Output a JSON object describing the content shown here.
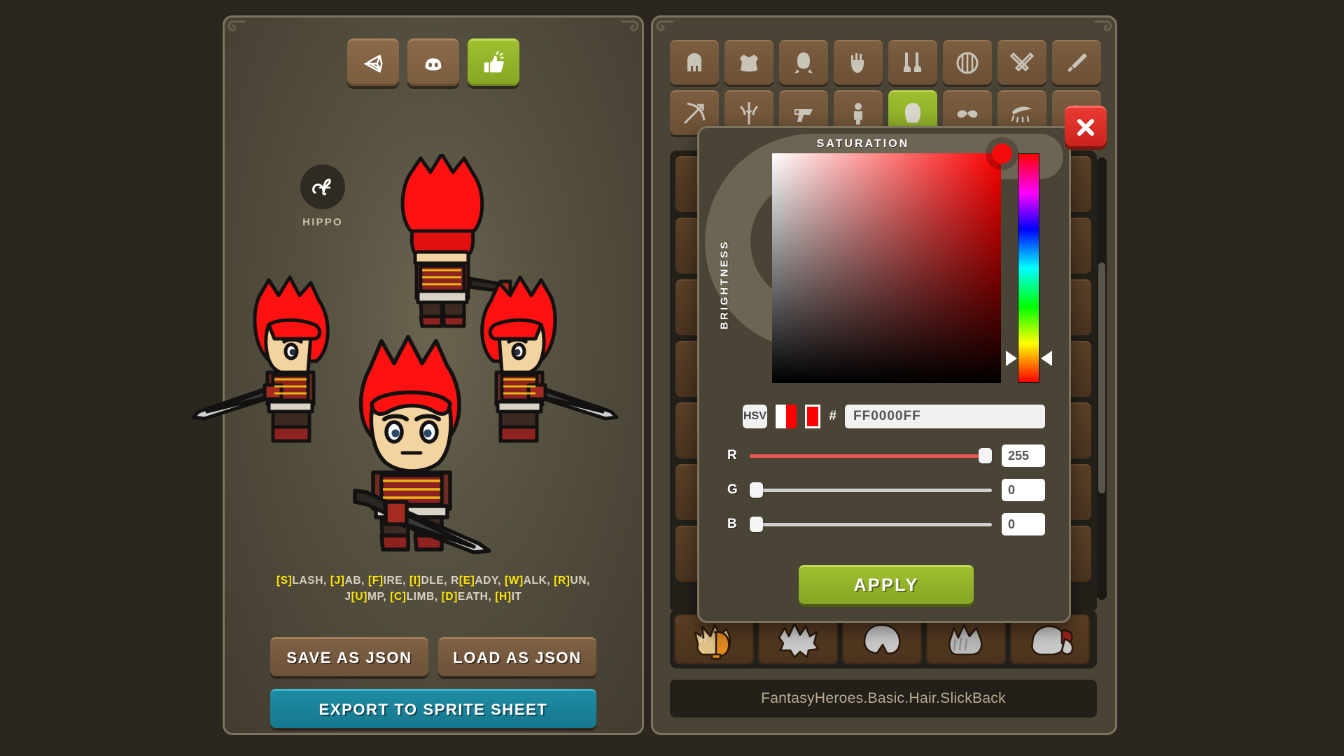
{
  "app": {
    "background_color": "#2b261e",
    "panel_color": "#4a4436",
    "panel_border_color": "#7d7460",
    "accent_green": "#93b329",
    "accent_teal": "#1e8ba3",
    "accent_red": "#d62a22",
    "highlight_yellow": "#ffe600"
  },
  "left_panel": {
    "toolbar": [
      {
        "name": "unity-icon",
        "label": "Unity"
      },
      {
        "name": "discord-icon",
        "label": "Discord"
      },
      {
        "name": "thumbs-up-icon",
        "label": "Rate"
      }
    ],
    "brand": {
      "icon": "hippo-monogram-icon",
      "label": "HIPPO"
    },
    "pan_handle": {
      "name": "move-handle-icon"
    },
    "key_hints": [
      {
        "key": "S",
        "rest": "LASH, "
      },
      {
        "key": "J",
        "rest": "AB, "
      },
      {
        "key": "F",
        "rest": "IRE, "
      },
      {
        "key": "I",
        "rest": "DLE, "
      },
      {
        "pre": "R",
        "key": "E",
        "rest": "ADY, "
      },
      {
        "key": "W",
        "rest": "ALK, "
      },
      {
        "key": "R",
        "rest": "UN,"
      },
      {
        "br": true
      },
      {
        "pre": "J",
        "key": "U",
        "rest": "MP, "
      },
      {
        "key": "C",
        "rest": "LIMB, "
      },
      {
        "key": "D",
        "rest": "EATH, "
      },
      {
        "key": "H",
        "rest": "IT"
      }
    ],
    "key_hints_line1": "[S]LASH, [J]AB, [F]IRE, [I]DLE, R[E]ADY, [W]ALK, [R]UN,",
    "key_hints_line2": "J[U]MP, [C]LIMB, [D]EATH, [H]IT",
    "buttons": {
      "save_json": "SAVE AS JSON",
      "load_json": "LOAD AS JSON",
      "export_sheet": "EXPORT TO SPRITE SHEET"
    },
    "character": {
      "hair_color": "#ff0000",
      "skin_color": "#f3d3a0",
      "armor_color": "#8e2220",
      "trim_color": "#f5c518",
      "views": [
        "back",
        "left",
        "right",
        "front"
      ]
    }
  },
  "right_panel": {
    "equipment_rows": [
      [
        {
          "name": "helmet-icon",
          "label": "Helmet",
          "active": false
        },
        {
          "name": "armor-icon",
          "label": "Armor",
          "active": false
        },
        {
          "name": "back-icon",
          "label": "Back",
          "active": false
        },
        {
          "name": "glove-icon",
          "label": "Gloves",
          "active": false
        },
        {
          "name": "boots-icon",
          "label": "Boots",
          "active": false
        },
        {
          "name": "shield-icon",
          "label": "Shield",
          "active": false
        },
        {
          "name": "dual-swords-icon",
          "label": "Dual Swords",
          "active": false
        },
        {
          "name": "sword-icon",
          "label": "Sword",
          "active": false
        }
      ],
      [
        {
          "name": "bow-icon",
          "label": "Bow",
          "active": false
        },
        {
          "name": "crossbow-icon",
          "label": "Crossbow",
          "active": false
        },
        {
          "name": "pistol-icon",
          "label": "Pistol",
          "active": false
        },
        {
          "name": "body-icon",
          "label": "Body",
          "active": false
        },
        {
          "name": "hair-icon",
          "label": "Hair",
          "active": true
        },
        {
          "name": "moustache-icon",
          "label": "Facial Hair",
          "active": false
        },
        {
          "name": "eyebrow-icon",
          "label": "Eyebrows",
          "active": false
        },
        {
          "name": "eye-icon",
          "label": "Eyes",
          "active": false
        }
      ]
    ],
    "asset_path": "FantasyHeroes.Basic.Hair.SlickBack",
    "thumbnails": [
      {
        "name": "hair-thumb-slickback",
        "label": "SlickBack",
        "colored": true
      },
      {
        "name": "hair-thumb-spiky",
        "label": "Spiky",
        "colored": false
      },
      {
        "name": "hair-thumb-bowl",
        "label": "Bowl",
        "colored": false
      },
      {
        "name": "hair-thumb-swept",
        "label": "Swept",
        "colored": false
      },
      {
        "name": "hair-thumb-ponytail",
        "label": "Ponytail",
        "colored": false
      }
    ]
  },
  "color_picker": {
    "title_saturation": "SATURATION",
    "title_brightness": "BRIGHTNESS",
    "close_icon": "close-icon",
    "mode_button": "HSV",
    "hash_symbol": "#",
    "hex_value": "FF0000FF",
    "current_color": "#ff0000",
    "previous_color": "#ffffff",
    "sv_handle": {
      "saturation_pct": 100,
      "brightness_pct": 100
    },
    "hue_position_pct": 0,
    "channels": [
      {
        "label": "R",
        "value": "255",
        "percent": 100,
        "filled": true
      },
      {
        "label": "G",
        "value": "0",
        "percent": 0,
        "filled": false
      },
      {
        "label": "B",
        "value": "0",
        "percent": 0,
        "filled": false
      }
    ],
    "apply_button": "APPLY"
  }
}
